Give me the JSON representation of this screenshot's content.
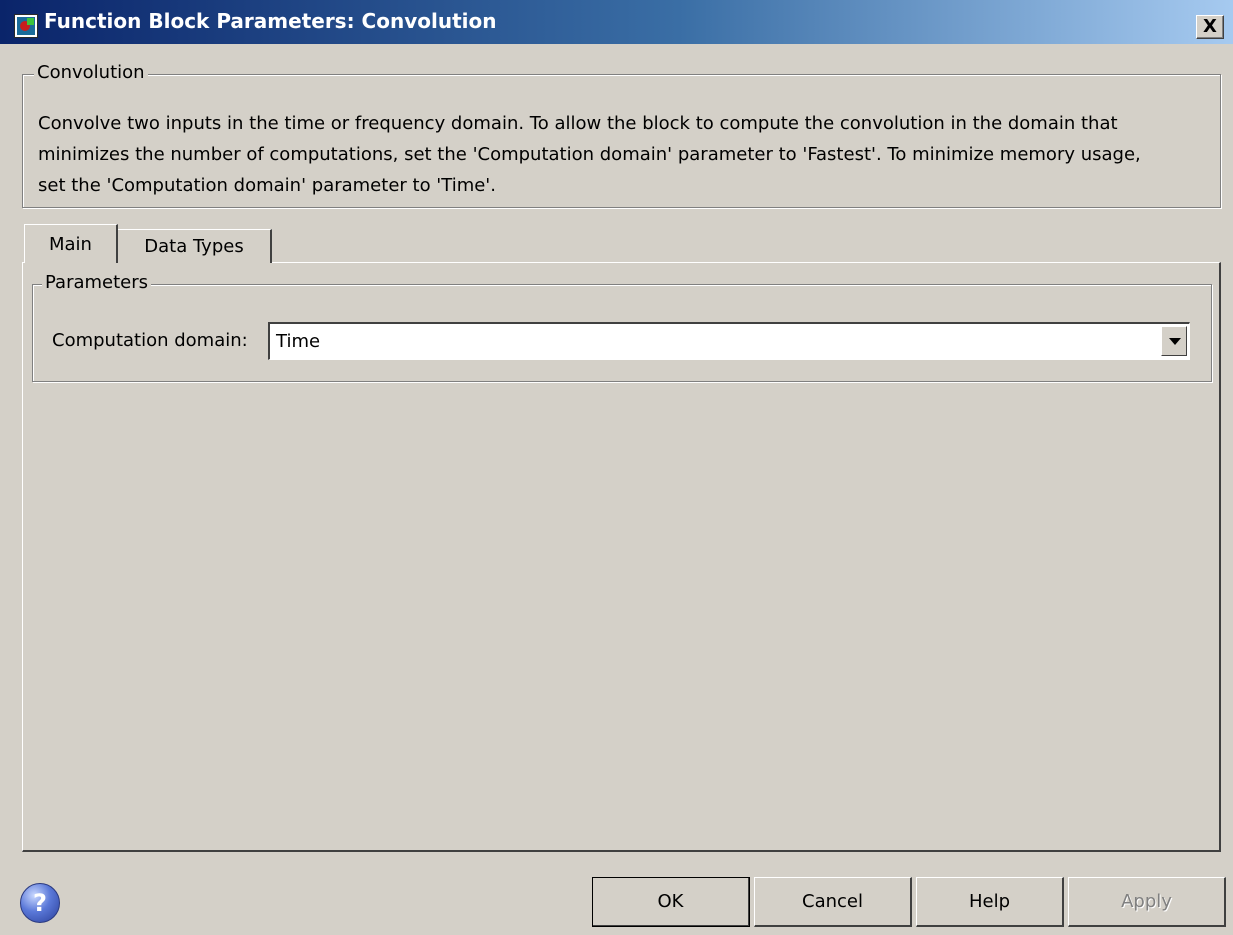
{
  "window": {
    "title": "Function Block Parameters: Convolution",
    "close_glyph": "X",
    "app_icon": "simulink-block-icon"
  },
  "block_group": {
    "legend": "Convolution",
    "description_lines": [
      "Convolve two inputs in the time or frequency domain. To allow the block to compute the convolution in the domain that",
      "minimizes the number of computations, set the 'Computation domain' parameter to 'Fastest'. To minimize memory usage,",
      "set the 'Computation domain' parameter to 'Time'."
    ]
  },
  "tabs": [
    {
      "label": "Main",
      "selected": true
    },
    {
      "label": "Data Types",
      "selected": false
    }
  ],
  "parameters": {
    "legend": "Parameters",
    "computation_domain": {
      "label": "Computation domain:",
      "value": "Time"
    }
  },
  "buttons": {
    "help_icon": "?",
    "ok": "OK",
    "cancel": "Cancel",
    "help": "Help",
    "apply": "Apply"
  }
}
